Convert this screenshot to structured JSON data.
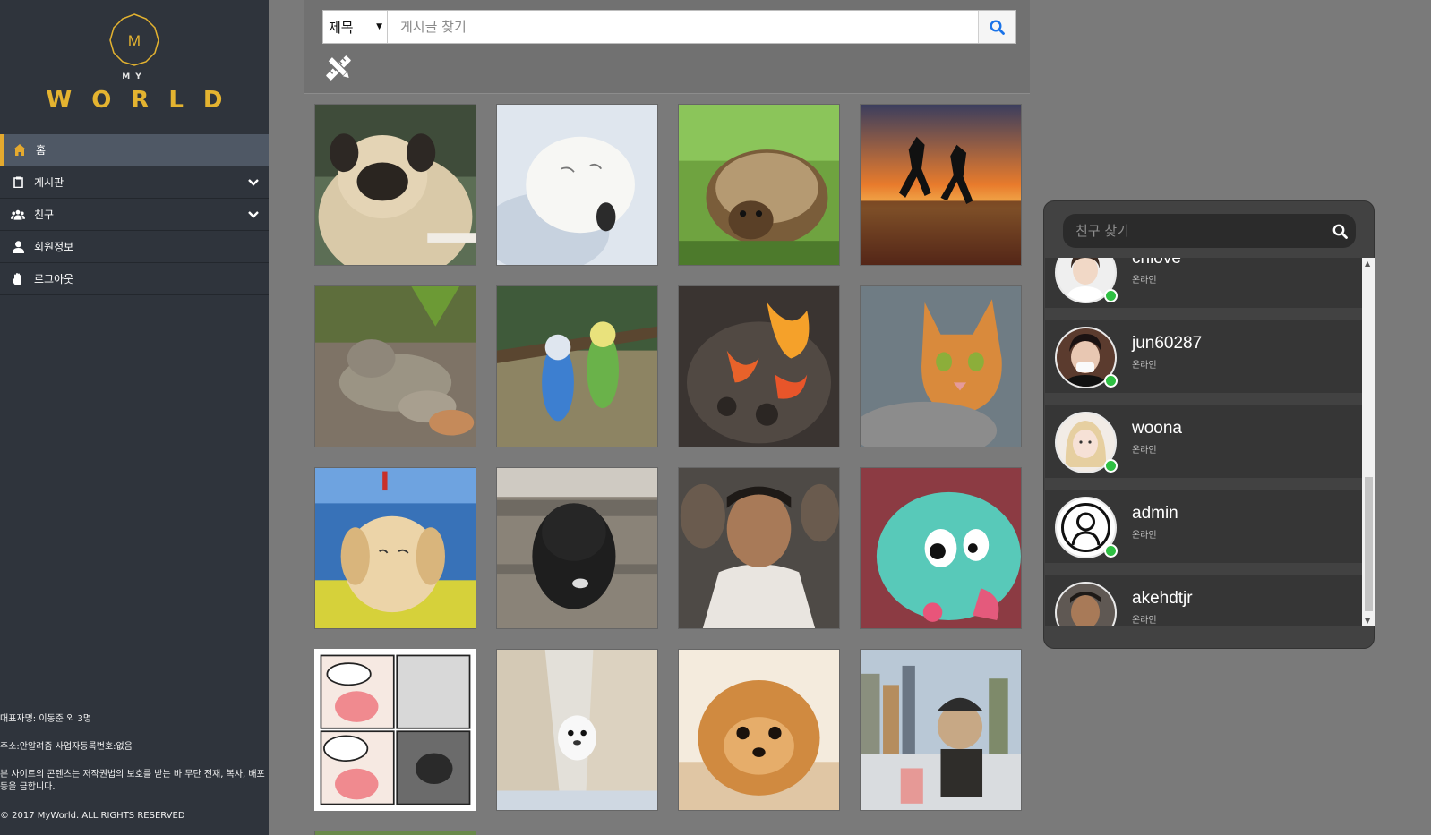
{
  "brand": {
    "hex_letter": "M",
    "my": "MY",
    "world": "WORLD",
    "accent_color": "#e4b330"
  },
  "sidebar": {
    "items": [
      {
        "label": "홈",
        "icon": "home-icon",
        "active": true
      },
      {
        "label": "게시판",
        "icon": "clipboard-icon",
        "expandable": true
      },
      {
        "label": "친구",
        "icon": "users-icon",
        "expandable": true
      },
      {
        "label": "회원정보",
        "icon": "user-icon"
      },
      {
        "label": "로그아웃",
        "icon": "hand-icon"
      }
    ],
    "footer": {
      "representative": "대표자명: 이동준 외 3명",
      "address": "주소:안알려줌 사업자등록번호:없음",
      "copyright_notice": "본 사이트의 콘텐츠는 저작권법의 보호를 받는 바 무단 전재, 복사, 배포 등을 금합니다.",
      "rights": "© 2017 MyWorld. ALL RIGHTS RESERVED"
    }
  },
  "search": {
    "category": "제목",
    "placeholder": "게시글 찾기",
    "search_icon": "search-icon"
  },
  "write_icon": "pencil-ruler-icon",
  "gallery": [
    "pug",
    "baby-seal",
    "hedgehog",
    "sunset-jumpers",
    "iguanas",
    "budgies",
    "fire-coals",
    "orange-cat",
    "puppy-flowers",
    "black-pug",
    "man-portrait",
    "cartoon-doraemon",
    "comic-strip",
    "polar-bear-seal",
    "pomeranian",
    "pug-city"
  ],
  "friends": {
    "search_placeholder": "친구 찾기",
    "list": [
      {
        "name": "chlove",
        "status": "온라인"
      },
      {
        "name": "jun60287",
        "status": "온라인"
      },
      {
        "name": "woona",
        "status": "온라인"
      },
      {
        "name": "admin",
        "status": "온라인"
      },
      {
        "name": "akehdtjr",
        "status": "온라인"
      }
    ],
    "online_color": "#2fc043"
  }
}
